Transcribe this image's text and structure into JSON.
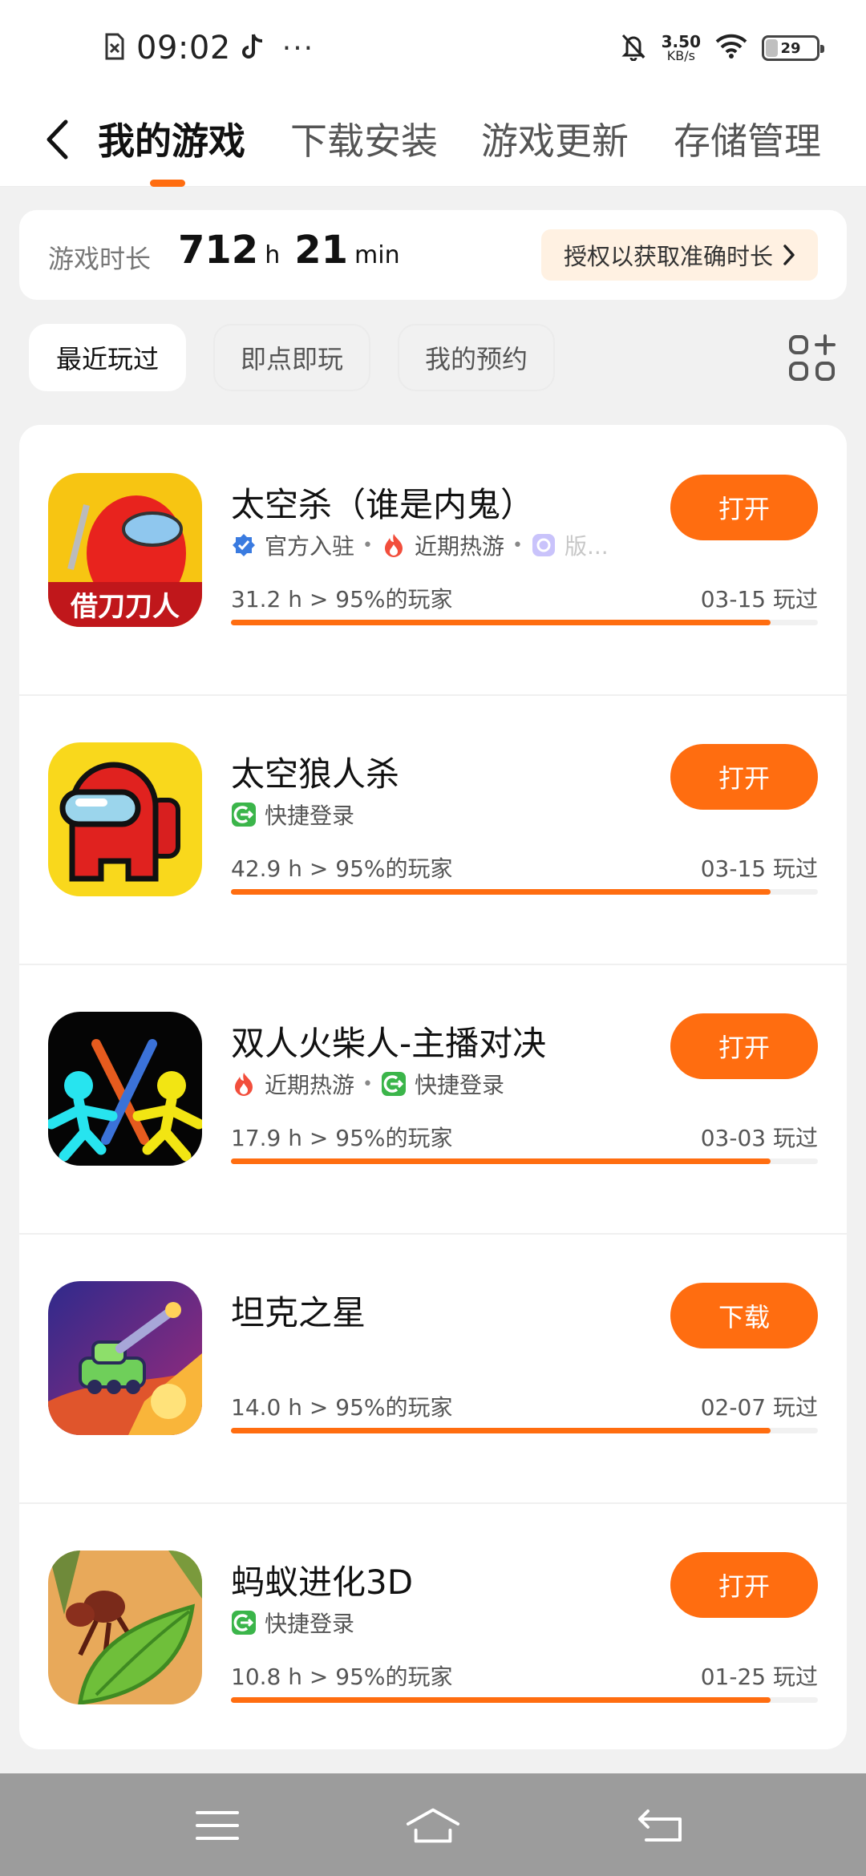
{
  "status_bar": {
    "time": "09:02",
    "dots": "···",
    "net_speed_value": "3.50",
    "net_speed_unit": "KB/s",
    "battery": "29",
    "battery_level": 0.29
  },
  "tabs": [
    {
      "label": "我的游戏",
      "active": true
    },
    {
      "label": "下载安装",
      "active": false
    },
    {
      "label": "游戏更新",
      "active": false
    },
    {
      "label": "存储管理",
      "active": false
    }
  ],
  "play_time": {
    "label": "游戏时长",
    "hours": "712",
    "hours_unit": "h",
    "minutes": "21",
    "minutes_unit": "min",
    "auth_button": "授权以获取准确时长"
  },
  "filters": [
    {
      "label": "最近玩过",
      "active": true
    },
    {
      "label": "即点即玩",
      "active": false
    },
    {
      "label": "我的预约",
      "active": false
    }
  ],
  "accent_color": "#ff6d10",
  "games": [
    {
      "title": "太空杀（谁是内鬼）",
      "tags": [
        "官方入驻",
        "近期热游",
        "版..."
      ],
      "hours": "31.2 h > 95%的玩家",
      "last_played": "03-15 玩过",
      "button": "打开",
      "progress": 0.92,
      "icon_text": "借刀刀人"
    },
    {
      "title": "太空狼人杀",
      "tags": [
        "快捷登录"
      ],
      "hours": "42.9 h > 95%的玩家",
      "last_played": "03-15 玩过",
      "button": "打开",
      "progress": 0.92
    },
    {
      "title": "双人火柴人-主播对决",
      "tags": [
        "近期热游",
        "快捷登录"
      ],
      "hours": "17.9 h > 95%的玩家",
      "last_played": "03-03 玩过",
      "button": "打开",
      "progress": 0.92
    },
    {
      "title": "坦克之星",
      "tags": [],
      "hours": "14.0 h > 95%的玩家",
      "last_played": "02-07 玩过",
      "button": "下载",
      "progress": 0.92
    },
    {
      "title": "蚂蚁进化3D",
      "tags": [
        "快捷登录"
      ],
      "hours": "10.8 h > 95%的玩家",
      "last_played": "01-25 玩过",
      "button": "打开",
      "progress": 0.92
    }
  ]
}
